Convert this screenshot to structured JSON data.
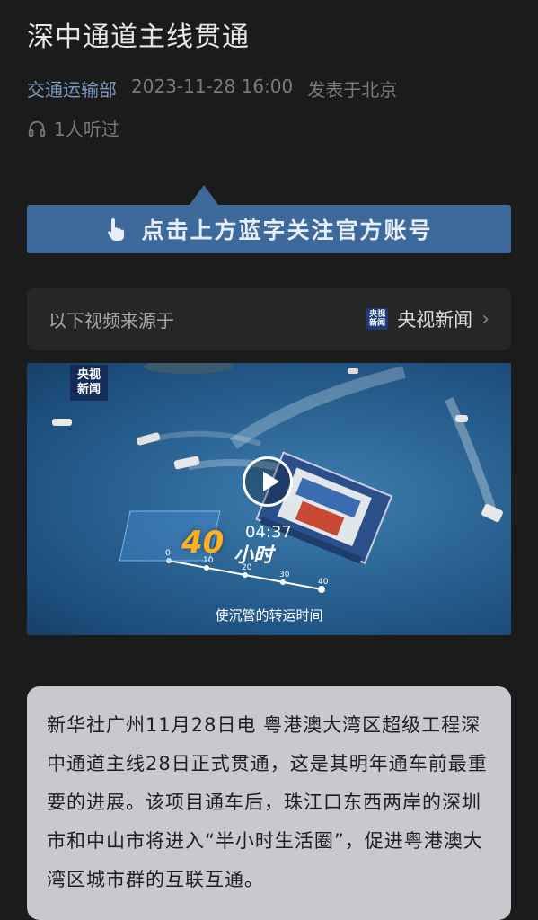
{
  "article": {
    "title": "深中通道主线贯通",
    "source": "交通运输部",
    "datetime": "2023-11-28 16:00",
    "location": "发表于北京",
    "listen_count": "1人听过",
    "follow_banner": "点击上方蓝字关注官方账号",
    "video_source": {
      "label": "以下视频来源于",
      "channel": "央视新闻",
      "logo_text_top": "央视",
      "logo_text_bottom": "新闻"
    },
    "video": {
      "watermark_top": "央视",
      "watermark_bottom": "新闻",
      "duration": "04:37",
      "overlay_number": "40",
      "overlay_unit": "小时",
      "caption": "使沉管的转运时间",
      "scale_ticks": [
        "0",
        "10",
        "20",
        "30",
        "40"
      ]
    },
    "body_text": "新华社广州11月28日电 粤港澳大湾区超级工程深中通道主线28日正式贯通，这是其明年通车前最重要的进展。该项目通车后，珠江口东西两岸的深圳市和中山市将进入“半小时生活圈”，促进粤港澳大湾区城市群的互联互通。"
  },
  "icons": {
    "listen": "headphones-icon",
    "pointer": "hand-pointer-icon",
    "play": "play-icon",
    "chevron": "chevron-right-icon"
  },
  "colors": {
    "background": "#1b1b1b",
    "accent_blue": "#3d6a9b",
    "source_link": "#7d9bc0",
    "article_card": "#c7c9ce"
  }
}
